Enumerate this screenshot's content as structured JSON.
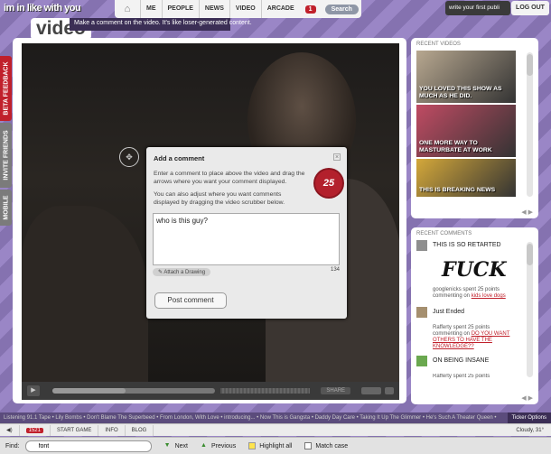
{
  "header": {
    "logo_line1": "im in like with you",
    "logo_line2": "video",
    "tagline": "Make a comment on the video. It's like loser-generated content.",
    "nav": [
      "ME",
      "PEOPLE",
      "NEWS",
      "VIDEO",
      "ARCADE"
    ],
    "notif_count": "1",
    "search_label": "Search",
    "write_box": "write your first publi",
    "logout": "LOG OUT"
  },
  "sidetabs": [
    "BETA FEEDBACK",
    "INVITE FRIENDS",
    "MOBILE"
  ],
  "dialog": {
    "title": "Add a comment",
    "p1": "Enter a comment to place above the video and drag the arrows where you want your comment displayed.",
    "p2": "You can also adjust where you want comments displayed by dragging the video scrubber below.",
    "badge": "25",
    "input_value": "who is this guy?",
    "attach": "Attach a Drawing",
    "char_count": "134",
    "post": "Post comment"
  },
  "player": {
    "share": "SHARE",
    "progress_fraction": 0.45
  },
  "recent_videos": {
    "header": "RECENT VIDEOS",
    "items": [
      {
        "caption": "YOU LOVED THIS SHOW AS MUCH AS HE DID.",
        "color": "#b8a890"
      },
      {
        "caption": "ONE MORE WAY TO MASTURBATE AT WORK",
        "color": "#c04b63"
      },
      {
        "caption": "THIS IS BREAKING NEWS",
        "color": "#d4a83a"
      }
    ]
  },
  "recent_comments": {
    "header": "RECENT COMMENTS",
    "items": [
      {
        "title": "THIS IS SO RETARTED",
        "drawing": "FUCK",
        "meta1": "googlenicks spent 25 points",
        "meta2": "commenting on",
        "link": "kids love dogs"
      },
      {
        "title": "Just Ended",
        "meta1": "Rafferty spent 25 points",
        "meta2": "commenting on",
        "link": "DO YOU WANT OTHERS TO HAVE THE KNOWLEDGE??"
      },
      {
        "title": "ON BEING INSANE",
        "meta1": "Rafferty spent 25 points"
      }
    ]
  },
  "ticker": {
    "text": "Listening 91.1 Tape  •  Lily Bombs  •  Don't Blame The Superbeed  •  From London, With Love  •  introducing...  •  Now This is Gangsta  •  Daddy Day Care  •  Taking It Up The Glimmer  •  He's Such A Theater Queen  •",
    "options": "Ticker Options"
  },
  "statusbar": {
    "count": "1521",
    "items": [
      "START GAME",
      "INFO",
      "BLOG"
    ],
    "weather": "Cloudy, 31°"
  },
  "findbar": {
    "label": "Find:",
    "value": "font",
    "next": "Next",
    "previous": "Previous",
    "highlight": "Highlight all",
    "match": "Match case"
  }
}
